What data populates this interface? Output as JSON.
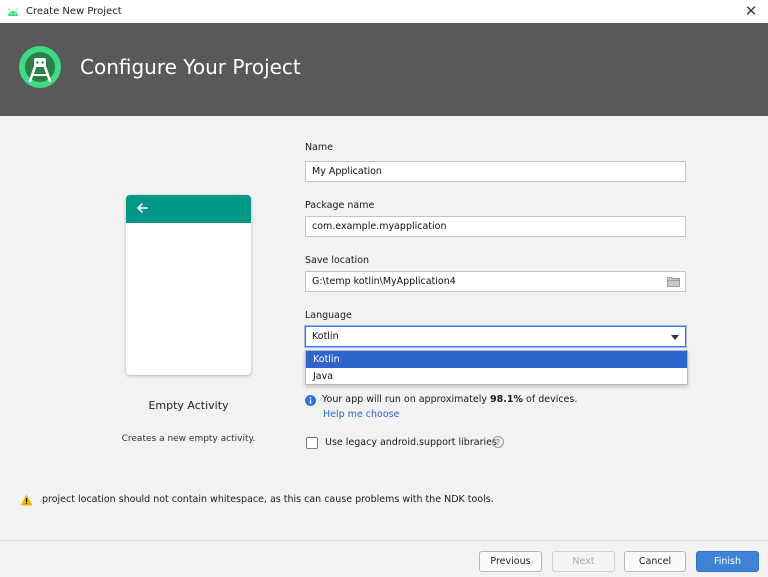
{
  "window": {
    "title": "Create New Project",
    "close_glyph": "✕",
    "app_icon": "android-icon"
  },
  "header": {
    "title": "Configure Your Project",
    "logo": "android-studio-logo"
  },
  "template": {
    "name": "Empty Activity",
    "description": "Creates a new empty activity.",
    "appbar_color": "#009688",
    "back_icon": "arrow-left-icon"
  },
  "form": {
    "name": {
      "label": "Name",
      "value": "My Application"
    },
    "package": {
      "label": "Package name",
      "value": "com.example.myapplication"
    },
    "location": {
      "label": "Save location",
      "value": "G:\\temp kotlin\\MyApplication4",
      "icon": "folder-icon"
    },
    "language": {
      "label": "Language",
      "value": "Kotlin",
      "options": [
        "Kotlin",
        "Java"
      ],
      "selected_index": 0
    },
    "info": {
      "prefix": "Your app will run on approximately ",
      "percent": "98.1%",
      "suffix": " of devices.",
      "link": "Help me choose"
    },
    "legacy": {
      "label": "Use legacy android.support libraries",
      "checked": false,
      "help_glyph": "?"
    }
  },
  "warning": {
    "text": "project location should not contain whitespace, as this can cause problems with the NDK tools.",
    "color": "#f0b400"
  },
  "buttons": {
    "previous": "Previous",
    "next": "Next",
    "cancel": "Cancel",
    "finish": "Finish",
    "finish_color": "#3f82d6"
  }
}
